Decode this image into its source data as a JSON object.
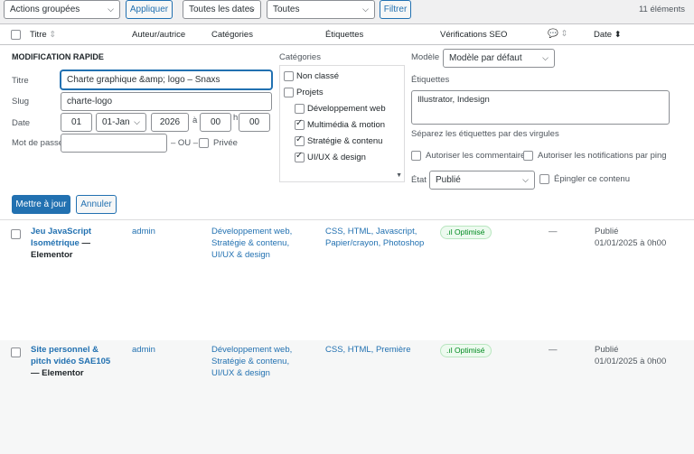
{
  "toolbar": {
    "bulk_actions": "Actions groupées",
    "apply": "Appliquer",
    "dates": "Toutes les dates",
    "categories": "Toutes",
    "filter": "Filtrer",
    "count": "11 éléments"
  },
  "table_header": {
    "title": "Titre",
    "author": "Auteur/autrice",
    "categories": "Catégories",
    "tags": "Étiquettes",
    "seo": "Vérifications SEO",
    "date": "Date"
  },
  "quick_edit": {
    "heading": "MODIFICATION RAPIDE",
    "title_label": "Titre",
    "title_value": "Charte graphique &amp; logo – Snaxs",
    "slug_label": "Slug",
    "slug_value": "charte-logo",
    "date_label": "Date",
    "day": "01",
    "month": "01-Jan",
    "year": "2026",
    "at": "à",
    "hour": "00",
    "h": "h",
    "minute": "00",
    "password_label": "Mot de passe",
    "or": "– OU –",
    "private": "Privée",
    "categories_label": "Catégories",
    "categories": [
      {
        "label": "Non classé",
        "checked": false,
        "indent": false
      },
      {
        "label": "Projets",
        "checked": false,
        "indent": false
      },
      {
        "label": "Développement web",
        "checked": false,
        "indent": true
      },
      {
        "label": "Multimédia & motion",
        "checked": true,
        "indent": true
      },
      {
        "label": "Stratégie & contenu",
        "checked": true,
        "indent": true
      },
      {
        "label": "UI/UX & design",
        "checked": true,
        "indent": true
      }
    ],
    "template_label": "Modèle",
    "template_value": "Modèle par défaut",
    "tags_label": "Étiquettes",
    "tags_value": "Illustrator, Indesign",
    "tags_hint": "Séparez les étiquettes par des virgules",
    "allow_comments": "Autoriser les commentaires",
    "allow_pings": "Autoriser les notifications par ping",
    "status_label": "État",
    "status_value": "Publié",
    "sticky": "Épingler ce contenu",
    "update": "Mettre à jour",
    "cancel": "Annuler"
  },
  "rows": [
    {
      "title": "Jeu JavaScript Isométrique",
      "suffix": "— Elementor",
      "author": "admin",
      "categories": "Développement web, Stratégie & contenu, UI/UX & design",
      "tags": "CSS, HTML, Javascript, Papier/crayon, Photoshop",
      "seo": "Optimisé",
      "comments": "—",
      "status": "Publié",
      "date": "01/01/2025 à 0h00"
    },
    {
      "title": "Site personnel & pitch vidéo SAE105",
      "suffix": "— Elementor",
      "author": "admin",
      "categories": "Développement web, Stratégie & contenu, UI/UX & design",
      "tags": "CSS, HTML, Première",
      "seo": "Optimisé",
      "comments": "—",
      "status": "Publié",
      "date": "01/01/2025 à 0h00"
    }
  ]
}
